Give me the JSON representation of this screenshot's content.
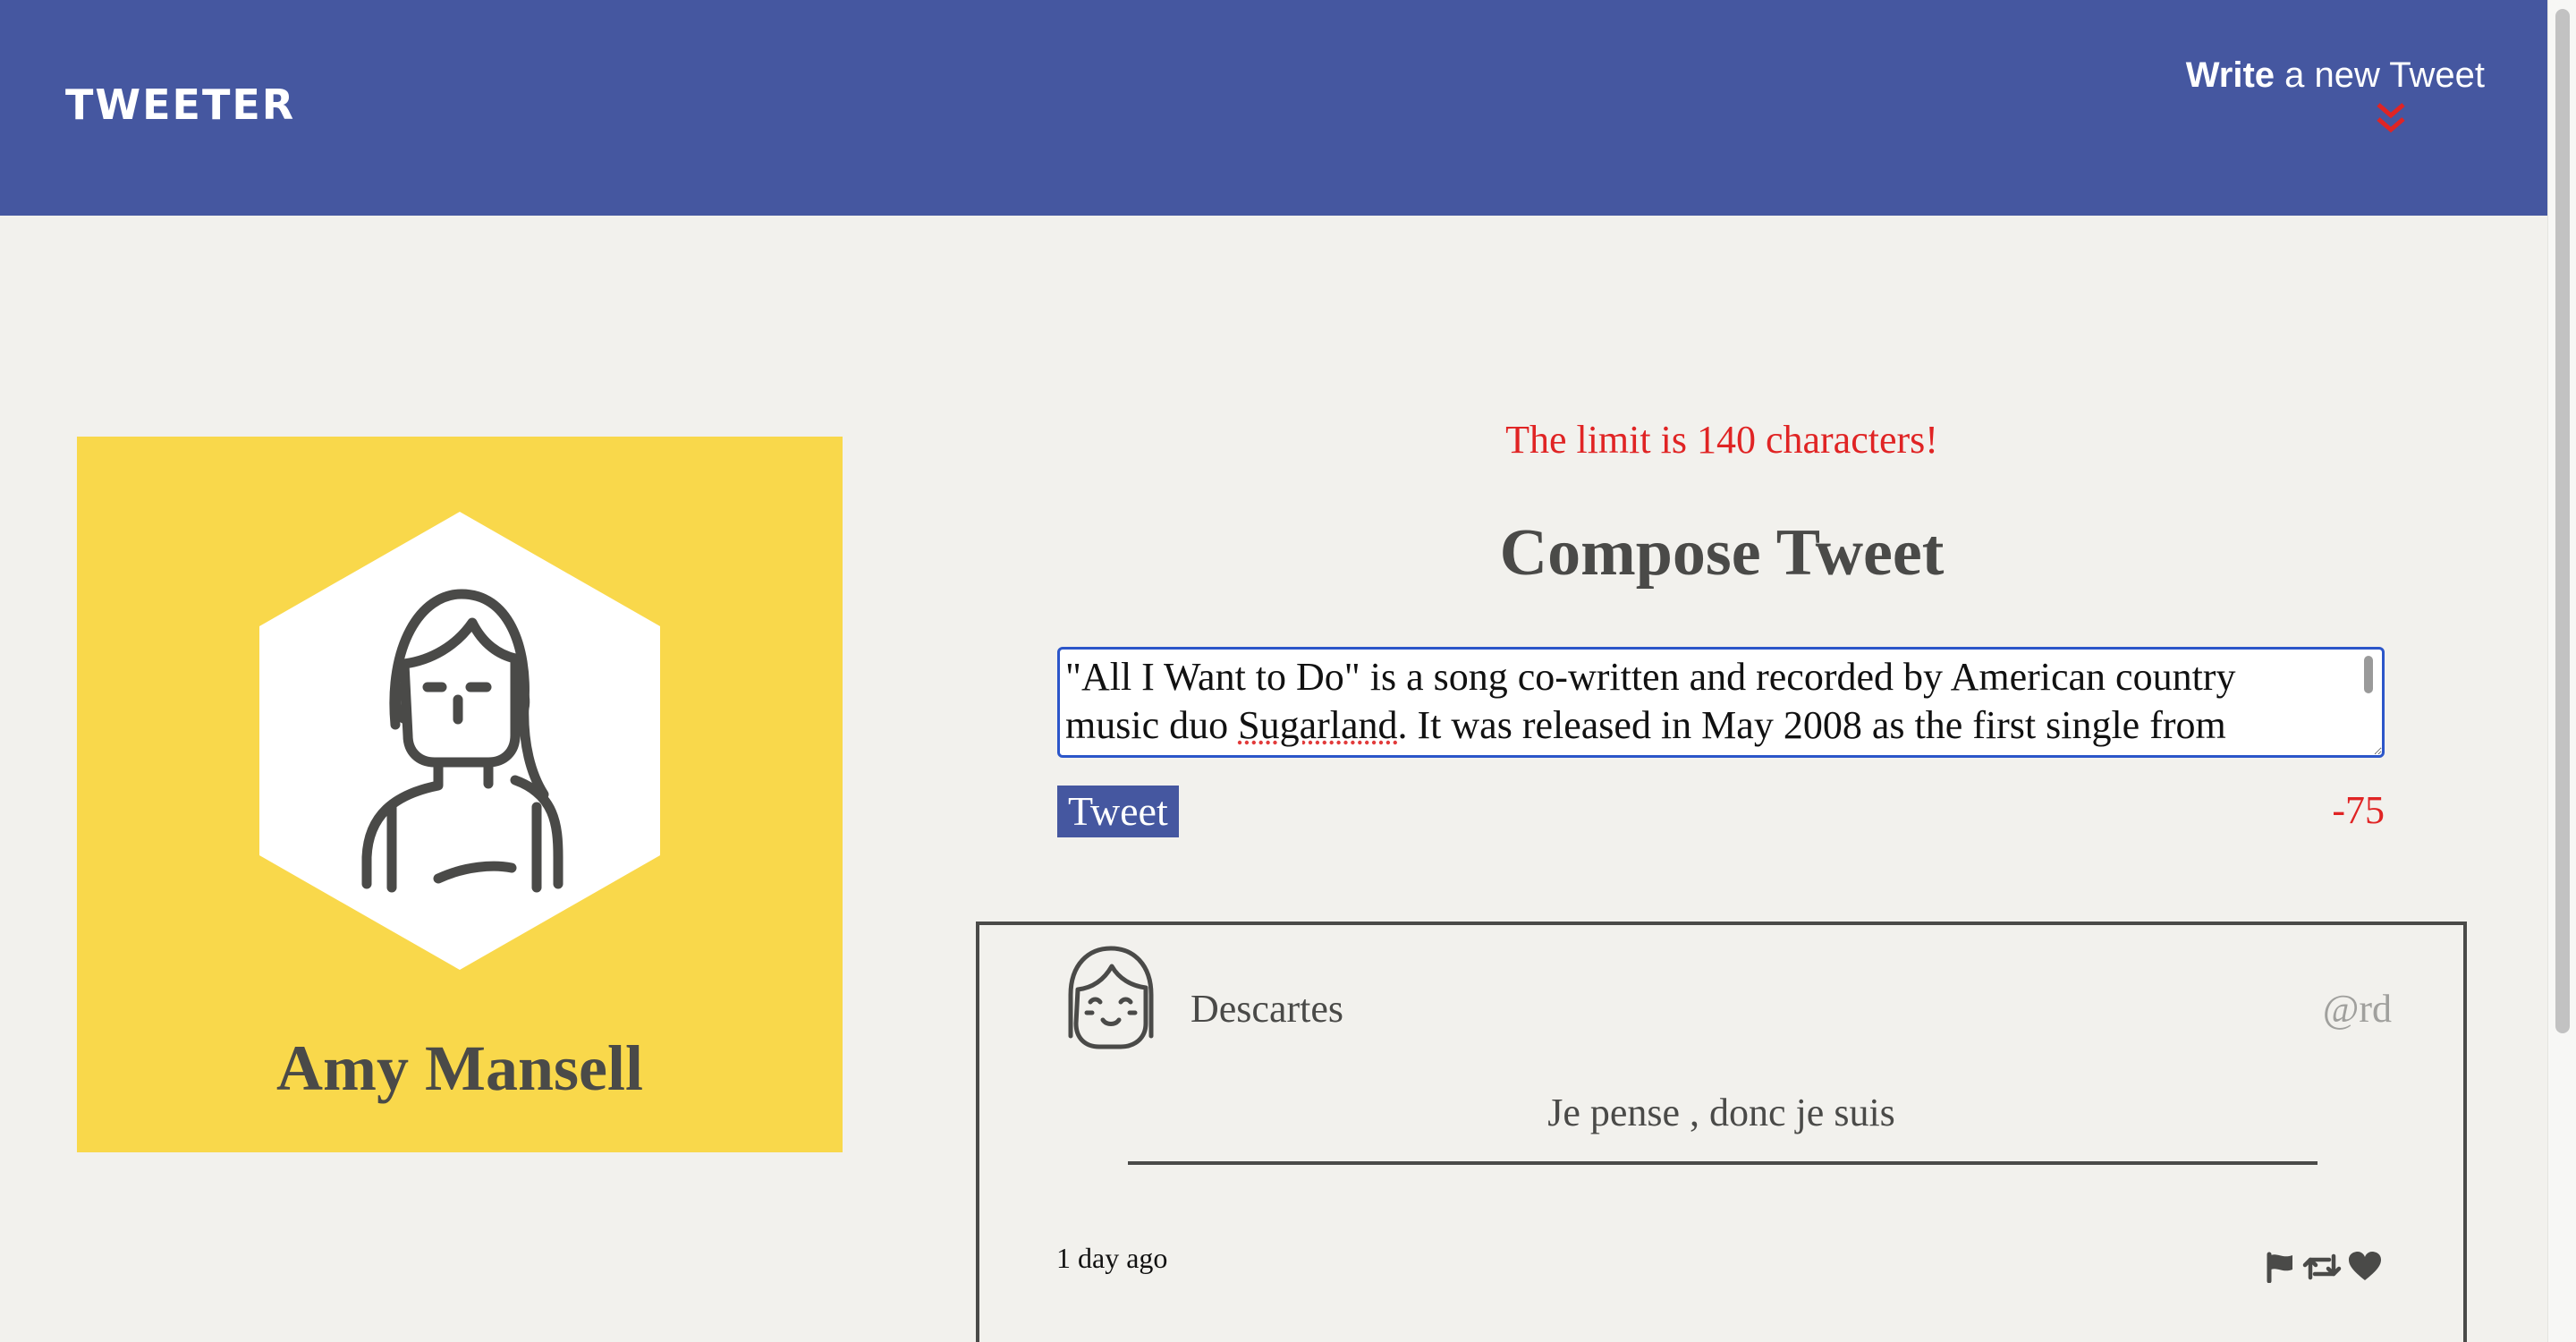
{
  "nav": {
    "brand": "TWEETER",
    "compose_bold": "Write",
    "compose_rest": " a new Tweet",
    "chevron_icon": "double-chevron-down-icon",
    "background_color": "#4557a0",
    "chevron_color": "#e02424"
  },
  "profile": {
    "name": "Amy Mansell",
    "avatar_icon": "user-avatar-icon",
    "background_color": "#f9d84b"
  },
  "composer": {
    "limit_warning": "The limit is 140 characters!",
    "title": "Compose Tweet",
    "input_line1": "\"All I Want to Do\" is a song co-written and recorded by American country",
    "input_line2_before": "music duo ",
    "input_line2_misspelled": "Sugarland",
    "input_line2_after": ". It was released in May 2008 as the first single from",
    "submit_label": "Tweet",
    "char_counter": "-75",
    "warning_color": "#e02424"
  },
  "tweets": [
    {
      "user_name": "Descartes",
      "handle": "@rd",
      "avatar_icon": "smiling-user-avatar-icon",
      "content": "Je pense , donc je suis",
      "time_ago": "1 day ago",
      "actions": [
        "flag-icon",
        "retweet-icon",
        "heart-icon"
      ]
    }
  ]
}
